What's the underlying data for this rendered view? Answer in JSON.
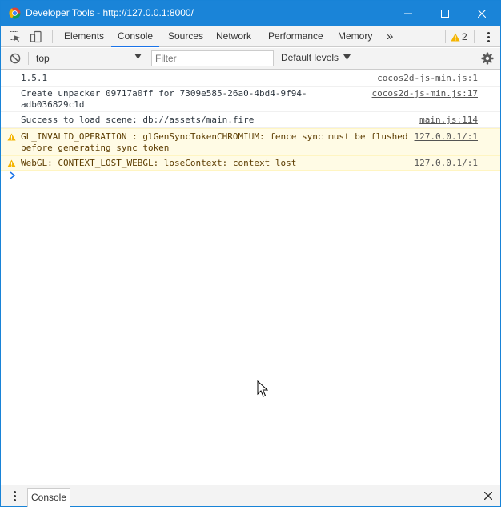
{
  "window": {
    "title": "Developer Tools - http://127.0.0.1:8000/"
  },
  "tabs": [
    {
      "label": "Elements",
      "active": false
    },
    {
      "label": "Console",
      "active": true
    },
    {
      "label": "Sources",
      "active": false
    },
    {
      "label": "Network",
      "active": false
    },
    {
      "label": "Performance",
      "active": false
    },
    {
      "label": "Memory",
      "active": false
    }
  ],
  "more_tabs_glyph": "»",
  "warnings_count": "2",
  "toolbar": {
    "context": "top",
    "filter_placeholder": "Filter",
    "filter_value": "",
    "levels_label": "Default levels"
  },
  "messages": [
    {
      "level": "log",
      "text": "1.5.1",
      "source": "cocos2d-js-min.js:1"
    },
    {
      "level": "log",
      "text": "Create unpacker 09717a0ff for 7309e585-26a0-4bd4-9f94-\nadb036829c1d",
      "source": "cocos2d-js-min.js:17"
    },
    {
      "level": "log",
      "text": "Success to load scene: db://assets/main.fire",
      "source": "main.js:114"
    },
    {
      "level": "warning",
      "text": "GL_INVALID_OPERATION : glGenSyncTokenCHROMIUM: fence sync must be flushed\nbefore generating sync token",
      "source": "127.0.0.1/:1"
    },
    {
      "level": "warning",
      "text": "WebGL: CONTEXT_LOST_WEBGL: loseContext: context lost",
      "source": "127.0.0.1/:1"
    }
  ],
  "drawer": {
    "tab_label": "Console"
  },
  "colors": {
    "titlebar": "#1a84d8",
    "active_tab_underline": "#1a73e8",
    "warning_bg": "#fffbe5",
    "warning_icon": "#f4b400",
    "prompt": "#1a73e8"
  }
}
